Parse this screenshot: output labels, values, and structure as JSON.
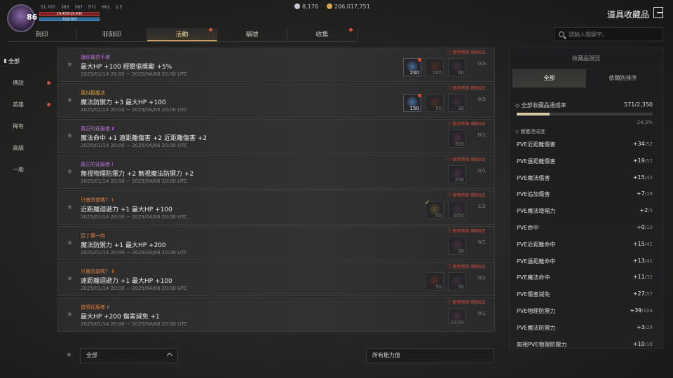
{
  "player": {
    "level": "86",
    "stats": [
      "51,767",
      "383",
      "587",
      "571",
      "661",
      "2,5"
    ],
    "hp": "19,400/19,400",
    "mp": "700/700"
  },
  "currency": [
    {
      "value": "8,176",
      "color": "#c8c8d8"
    },
    {
      "value": "206,017,751",
      "color": "#d4a84a"
    }
  ],
  "title": "道具收藏品",
  "tabs": [
    {
      "label": "刻印",
      "dot": false
    },
    {
      "label": "非刻印",
      "dot": false
    },
    {
      "label": "活動",
      "dot": true,
      "active": true
    },
    {
      "label": "稱號",
      "dot": false
    },
    {
      "label": "收集",
      "dot": true
    }
  ],
  "search": {
    "placeholder": "請輸入關鍵字。"
  },
  "sidebar": [
    {
      "label": "全部",
      "active": true
    },
    {
      "label": "傳說",
      "dot": true
    },
    {
      "label": "英雄",
      "dot": true
    },
    {
      "label": "稀有"
    },
    {
      "label": "高級"
    },
    {
      "label": "一般"
    }
  ],
  "rows": [
    {
      "name": "讓你痛苦不堪",
      "name_color": "#c070e0",
      "effect": "最大HP +100 經驗值獎勵 +5%",
      "date": "2025/01/14 20:00 ~ 2025/04/08 20:00 UTC",
      "limit": "使用時限 剩餘8日",
      "count": "0/3",
      "slots": [
        {
          "n": "240",
          "color": "#4a6a9a",
          "bright": true,
          "badge": true
        },
        {
          "n": "100",
          "color": "#7a3a2a"
        },
        {
          "n": "60",
          "color": "#5a3a5a"
        }
      ]
    },
    {
      "name": "真討厭魔法",
      "name_color": "#e0a040",
      "effect": "魔法防禦力 +3 最大HP +100",
      "date": "2025/01/14 20:00 ~ 2025/04/08 20:00 UTC",
      "limit": "使用時限 剩餘8日",
      "count": "0/3",
      "slots": [
        {
          "n": "150",
          "color": "#4a6a9a",
          "bright": true,
          "badge": true
        },
        {
          "n": "50",
          "color": "#7a3a2a"
        },
        {
          "n": "30",
          "color": "#5a3a5a"
        }
      ]
    },
    {
      "name": "真正的征服者 II",
      "name_color": "#c070e0",
      "effect": "魔法命中 +1 遠距離傷害 +2 近距離傷害 +2",
      "date": "2025/01/14 20:00 ~ 2025/04/08 20:00 UTC",
      "limit": "使用時限 剩餘8日",
      "count": "0/1",
      "slots": [
        {
          "n": "300",
          "color": "#6a3a5a"
        }
      ]
    },
    {
      "name": "真正的征服者 I",
      "name_color": "#c070e0",
      "effect": "無視物理防禦力 +2 無視魔法防禦力 +2",
      "date": "2025/01/14 20:00 ~ 2025/04/08 20:00 UTC",
      "limit": "使用時限 剩餘8日",
      "count": "0/1",
      "slots": [
        {
          "n": "200",
          "color": "#6a3a5a"
        }
      ]
    },
    {
      "name": "只會防禦嗎？ I",
      "name_color": "#e08040",
      "effect": "近距離迴避力 +1 最大HP +100",
      "date": "2025/01/14 20:00 ~ 2025/04/08 20:00 UTC",
      "limit": "使用時限 剩餘8日",
      "count": "1/2",
      "slots": [
        {
          "n": "50",
          "color": "#8a7a3a",
          "check": true
        },
        {
          "n": "0/50",
          "color": "#5a3a5a"
        }
      ]
    },
    {
      "name": "亞丁第一肉",
      "name_color": "#e08040",
      "effect": "魔法防禦力 +1 最大HP +200",
      "date": "2025/01/14 20:00 ~ 2025/04/08 20:00 UTC",
      "limit": "使用時限 剩餘8日",
      "count": "0/1",
      "slots": [
        {
          "n": "56",
          "color": "#6a3a5a"
        }
      ]
    },
    {
      "name": "只會防禦嗎？ II",
      "name_color": "#e08040",
      "effect": "遠距離迴避力 +1 最大HP +100",
      "date": "2025/01/14 20:00 ~ 2025/04/08 20:00 UTC",
      "limit": "使用時限 剩餘8日",
      "count": "0/2",
      "slots": [
        {
          "n": "50",
          "color": "#7a3a2a"
        },
        {
          "n": "50",
          "color": "#5a3a5a"
        }
      ]
    },
    {
      "name": "首領征服者 II",
      "name_color": "#e08040",
      "effect": "最大HP +200 傷害減免 +1",
      "date": "2025/01/14 20:00 ~ 2025/04/08 20:00 UTC",
      "limit": "使用時限 剩餘8日",
      "count": "0/1",
      "slots": [
        {
          "n": "20/40",
          "color": "#6a3a5a"
        }
      ]
    }
  ],
  "bottom": {
    "filter_left": "全部",
    "filter_right": "所有能力值"
  },
  "panel": {
    "header": "收藏品現況",
    "tabs": [
      "全部",
      "依類別排序"
    ],
    "progress_label": "全部收藏品達成率",
    "progress_value": "571/2,350",
    "progress_fraction": 0.243,
    "progress_pct": "24.3%",
    "group_label": "圖鑑達成度",
    "stats": [
      {
        "k": "PVE近距離傷害",
        "v": "+34",
        "t": "/52"
      },
      {
        "k": "PVE遠距離傷害",
        "v": "+19",
        "t": "/52"
      },
      {
        "k": "PVE魔法傷害",
        "v": "+15",
        "t": "/42"
      },
      {
        "k": "PVE追加傷害",
        "v": "+7",
        "t": "/19"
      },
      {
        "k": "PVE魔法增幅力",
        "v": "+2",
        "t": "/5"
      },
      {
        "k": "PVE命中",
        "v": "+0",
        "t": "/10"
      },
      {
        "k": "PVE近距離命中",
        "v": "+15",
        "t": "/41"
      },
      {
        "k": "PVE遠距離命中",
        "v": "+13",
        "t": "/41"
      },
      {
        "k": "PVE魔法命中",
        "v": "+11",
        "t": "/32"
      },
      {
        "k": "PVE傷害減免",
        "v": "+27",
        "t": "/57"
      },
      {
        "k": "PVE物理防禦力",
        "v": "+39",
        "t": "/104"
      },
      {
        "k": "PVE魔法防禦力",
        "v": "+3",
        "t": "/28"
      },
      {
        "k": "無視PVE物理防禦力",
        "v": "+10",
        "t": "/18"
      }
    ]
  }
}
